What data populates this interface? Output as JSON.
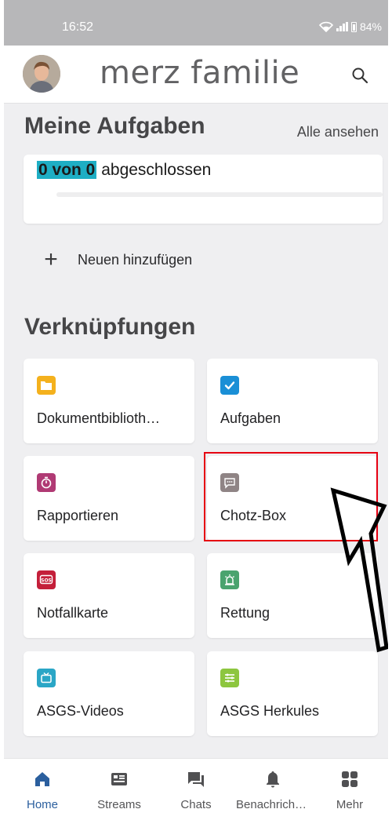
{
  "status_bar": {
    "time": "16:52",
    "battery": "84%"
  },
  "header": {
    "title": "merz familie",
    "avatar": "avatar",
    "search_icon": "search-icon"
  },
  "tasks": {
    "heading": "Meine Aufgaben",
    "see_all": "Alle ansehen",
    "progress_highlight": "0 von 0",
    "progress_suffix": "abgeschlossen",
    "progress_fraction": 0,
    "add_new": "Neuen hinzufügen"
  },
  "shortcuts": {
    "heading": "Verknüpfungen",
    "tiles": [
      {
        "label": "Dokumentbiblioth…",
        "icon": "folder-icon",
        "color": "#f4b11d"
      },
      {
        "label": "Aufgaben",
        "icon": "checkbox-icon",
        "color": "#1a8fd6"
      },
      {
        "label": "Rapportieren",
        "icon": "stopwatch-icon",
        "color": "#b03a74"
      },
      {
        "label": "Chotz-Box",
        "icon": "chat-box-icon",
        "color": "#8f8485"
      },
      {
        "label": "Notfallkarte",
        "icon": "sos-icon",
        "color": "#c41f3a"
      },
      {
        "label": "Rettung",
        "icon": "siren-icon",
        "color": "#4aa36e"
      },
      {
        "label": "ASGS-Videos",
        "icon": "tv-icon",
        "color": "#2aa6c6"
      },
      {
        "label": "ASGS Herkules",
        "icon": "herkules-icon",
        "color": "#8dc63f"
      }
    ]
  },
  "bottom_nav": [
    {
      "label": "Home",
      "icon": "home-icon",
      "active": true
    },
    {
      "label": "Streams",
      "icon": "streams-icon"
    },
    {
      "label": "Chats",
      "icon": "chats-icon"
    },
    {
      "label": "Benachricht…",
      "icon": "bell-icon"
    },
    {
      "label": "Mehr",
      "icon": "grid-icon"
    }
  ],
  "colors": {
    "accent": "#2b5f9e",
    "highlight": "#1eaec4",
    "annotation_red": "#e60012"
  }
}
